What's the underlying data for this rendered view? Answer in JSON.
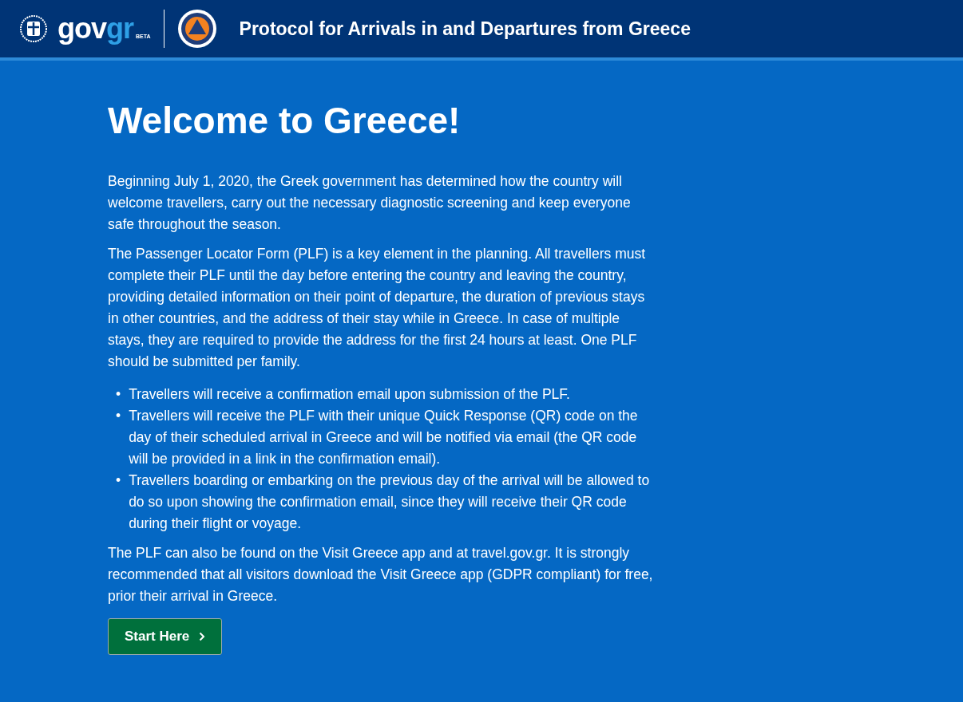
{
  "header": {
    "logo_text": "gov",
    "logo_accent": "gr",
    "beta": "BETA",
    "title": "Protocol for Arrivals in and Departures from Greece"
  },
  "main": {
    "heading": "Welcome to Greece!",
    "paragraphs": [
      "Beginning July 1, 2020, the Greek government has determined how the country will welcome travellers, carry out the necessary diagnostic screening and keep everyone safe throughout the season.",
      "The Passenger Locator Form (PLF) is a key element in the planning. All travellers must complete their PLF until the day before entering the country and leaving the country, providing detailed information on their point of departure, the duration of previous stays in other countries, and the address of their stay while in Greece. In case of multiple stays, they are required to provide the address for the first 24 hours at least. One PLF should be submitted per family."
    ],
    "bullets": [
      {
        "marker": "•",
        "text": "Travellers will receive a confirmation email upon submission of the PLF."
      },
      {
        "marker": "•",
        "text": "Travellers will receive the PLF with their unique Quick Response (QR) code on the day of their scheduled arrival in Greece and will be notified via email (the QR code will be provided in a link in the confirmation email)."
      },
      {
        "marker": "•",
        "text": "Travellers boarding or embarking on the previous day of the arrival will be allowed to do so upon showing the confirmation email, since they will receive their QR code during their flight or voyage."
      }
    ],
    "closing": "The PLF can also be found on the Visit Greece app and at travel.gov.gr. It is strongly recommended that all visitors download the Visit Greece app (GDPR compliant) for free, prior their arrival in Greece.",
    "button": "Start Here"
  }
}
